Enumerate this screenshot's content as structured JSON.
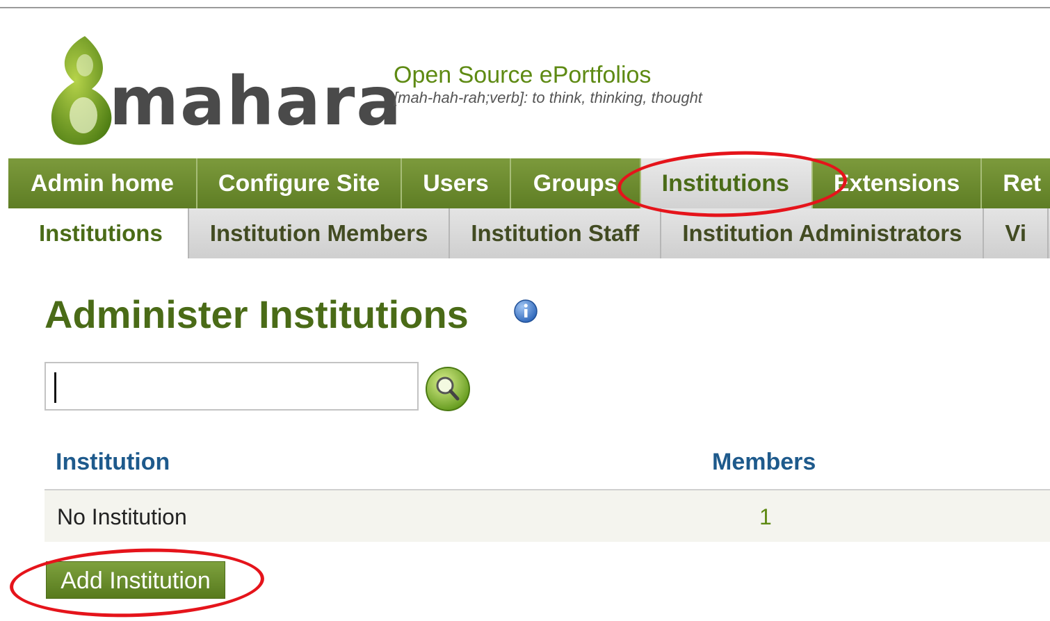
{
  "brand": {
    "logo_text": "mahara",
    "tagline_title": "Open Source ePortfolios",
    "tagline_sub": "[mah-hah-rah;verb]: to think, thinking, thought"
  },
  "nav_primary": {
    "admin_home": "Admin home",
    "configure_site": "Configure Site",
    "users": "Users",
    "groups": "Groups",
    "institutions": "Institutions",
    "extensions": "Extensions",
    "return": "Ret"
  },
  "nav_secondary": {
    "institutions": "Institutions",
    "members": "Institution Members",
    "staff": "Institution Staff",
    "administrators": "Institution Administrators",
    "views": "Vi"
  },
  "page": {
    "title": "Administer Institutions"
  },
  "search": {
    "value": ""
  },
  "table": {
    "col_institution": "Institution",
    "col_members": "Members",
    "rows": [
      {
        "institution": "No Institution",
        "members": "1"
      }
    ]
  },
  "actions": {
    "add_institution": "Add Institution"
  },
  "colors": {
    "brand_green": "#5e8a13",
    "nav_green": "#6b8a2f",
    "highlight_red": "#e5141b",
    "header_blue": "#1e5a8c"
  }
}
